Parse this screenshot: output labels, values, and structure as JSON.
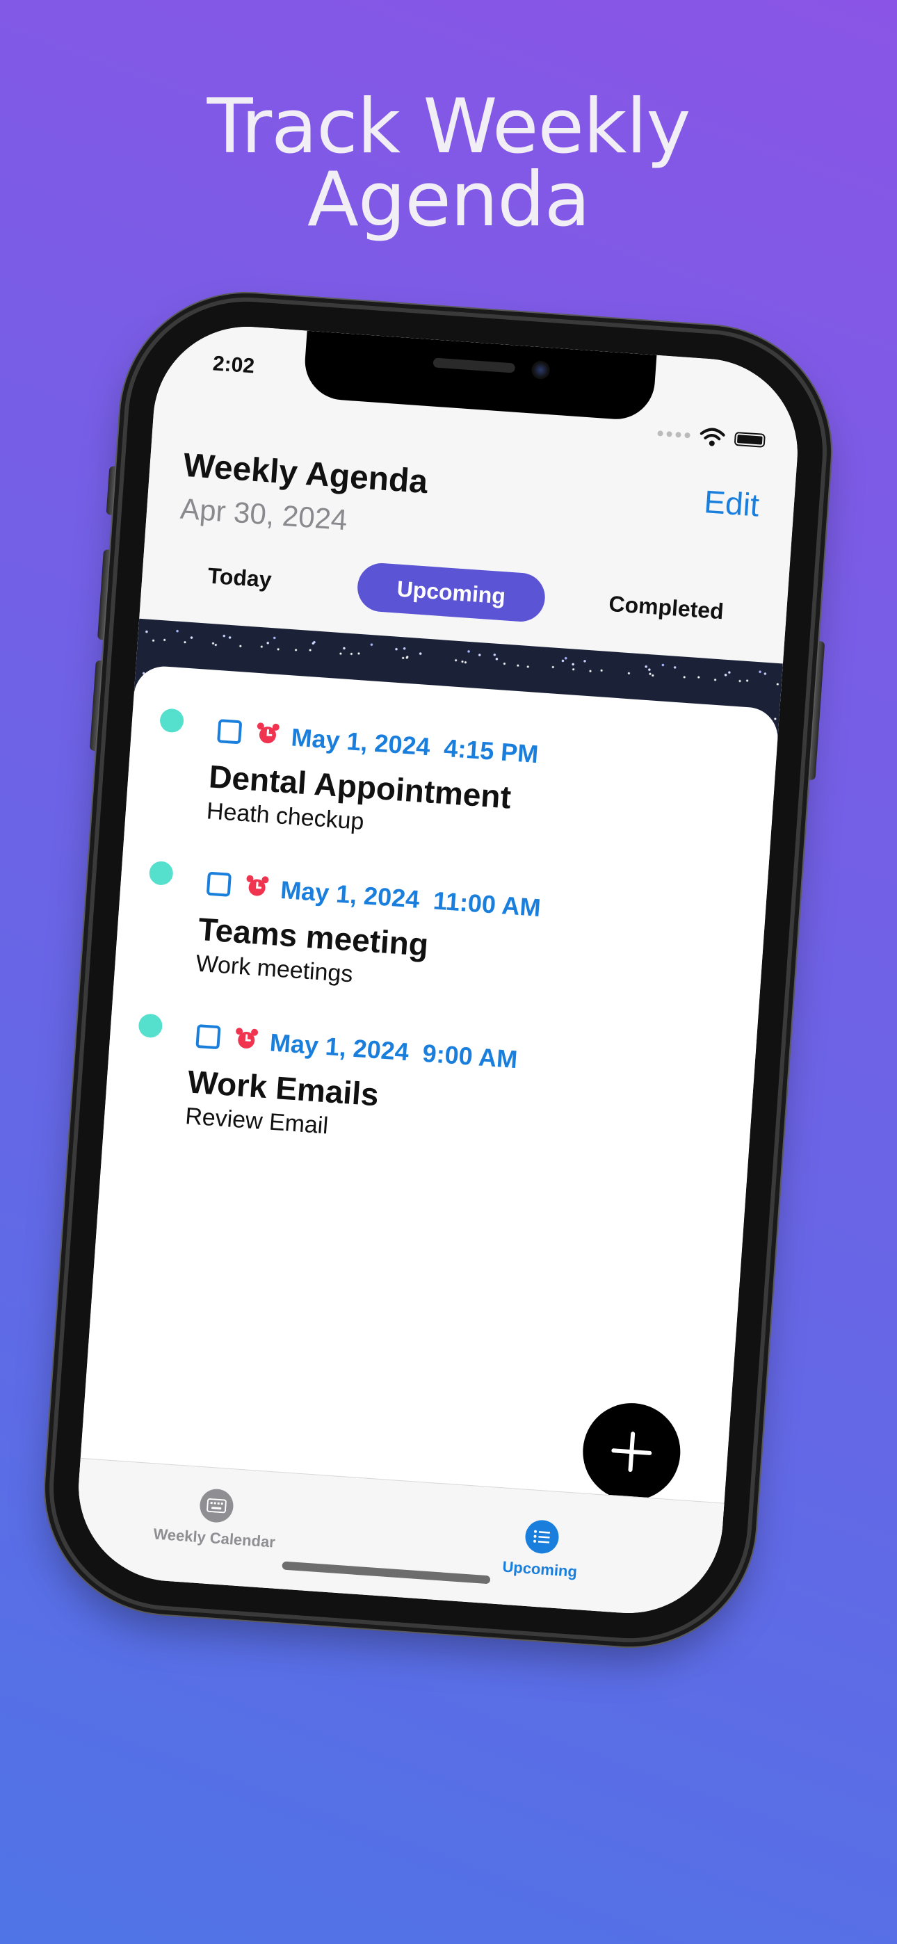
{
  "headline": {
    "line1": "Track Weekly",
    "line2": "Agenda"
  },
  "status_bar": {
    "time": "2:02"
  },
  "nav": {
    "title": "Weekly Agenda",
    "date": "Apr 30, 2024",
    "edit_label": "Edit"
  },
  "segments": {
    "today": "Today",
    "upcoming": "Upcoming",
    "completed": "Completed",
    "selected": "Upcoming"
  },
  "tasks": [
    {
      "date": "May 1, 2024",
      "time": "4:15 PM",
      "title": "Dental Appointment",
      "subtitle": "Heath checkup"
    },
    {
      "date": "May 1, 2024",
      "time": "11:00 AM",
      "title": "Teams meeting",
      "subtitle": "Work meetings"
    },
    {
      "date": "May 1, 2024",
      "time": "9:00 AM",
      "title": "Work Emails",
      "subtitle": "Review Email"
    }
  ],
  "tabbar": {
    "calendar_label": "Weekly Calendar",
    "upcoming_label": "Upcoming",
    "selected": "Upcoming"
  },
  "colors": {
    "accent": "#1a7fdc",
    "segment_selected": "#5b54d4",
    "task_dot": "#54e0cc",
    "alarm": "#f0334f",
    "background_top": "#8a55e6",
    "background_bottom": "#4f74e6"
  },
  "icons": {
    "alarm": "alarm-clock-icon",
    "fab": "plus-icon",
    "tab_calendar": "keyboard-calendar-icon",
    "tab_upcoming": "list-icon"
  }
}
